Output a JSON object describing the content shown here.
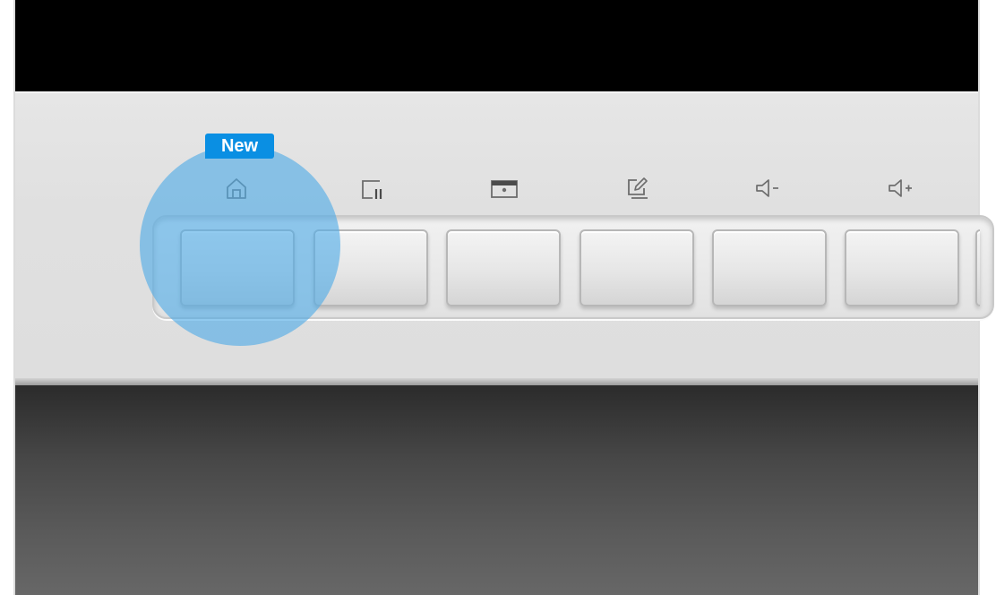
{
  "badge": {
    "label": "New",
    "color": "#0a8fe3"
  },
  "highlight": {
    "color": "#4fabe6",
    "target": "home-key"
  },
  "function_keys": [
    {
      "icon": "home-icon"
    },
    {
      "icon": "multiview-icon"
    },
    {
      "icon": "screen-display-icon"
    },
    {
      "icon": "edit-input-icon"
    },
    {
      "icon": "volume-down-icon"
    },
    {
      "icon": "volume-up-icon"
    }
  ]
}
